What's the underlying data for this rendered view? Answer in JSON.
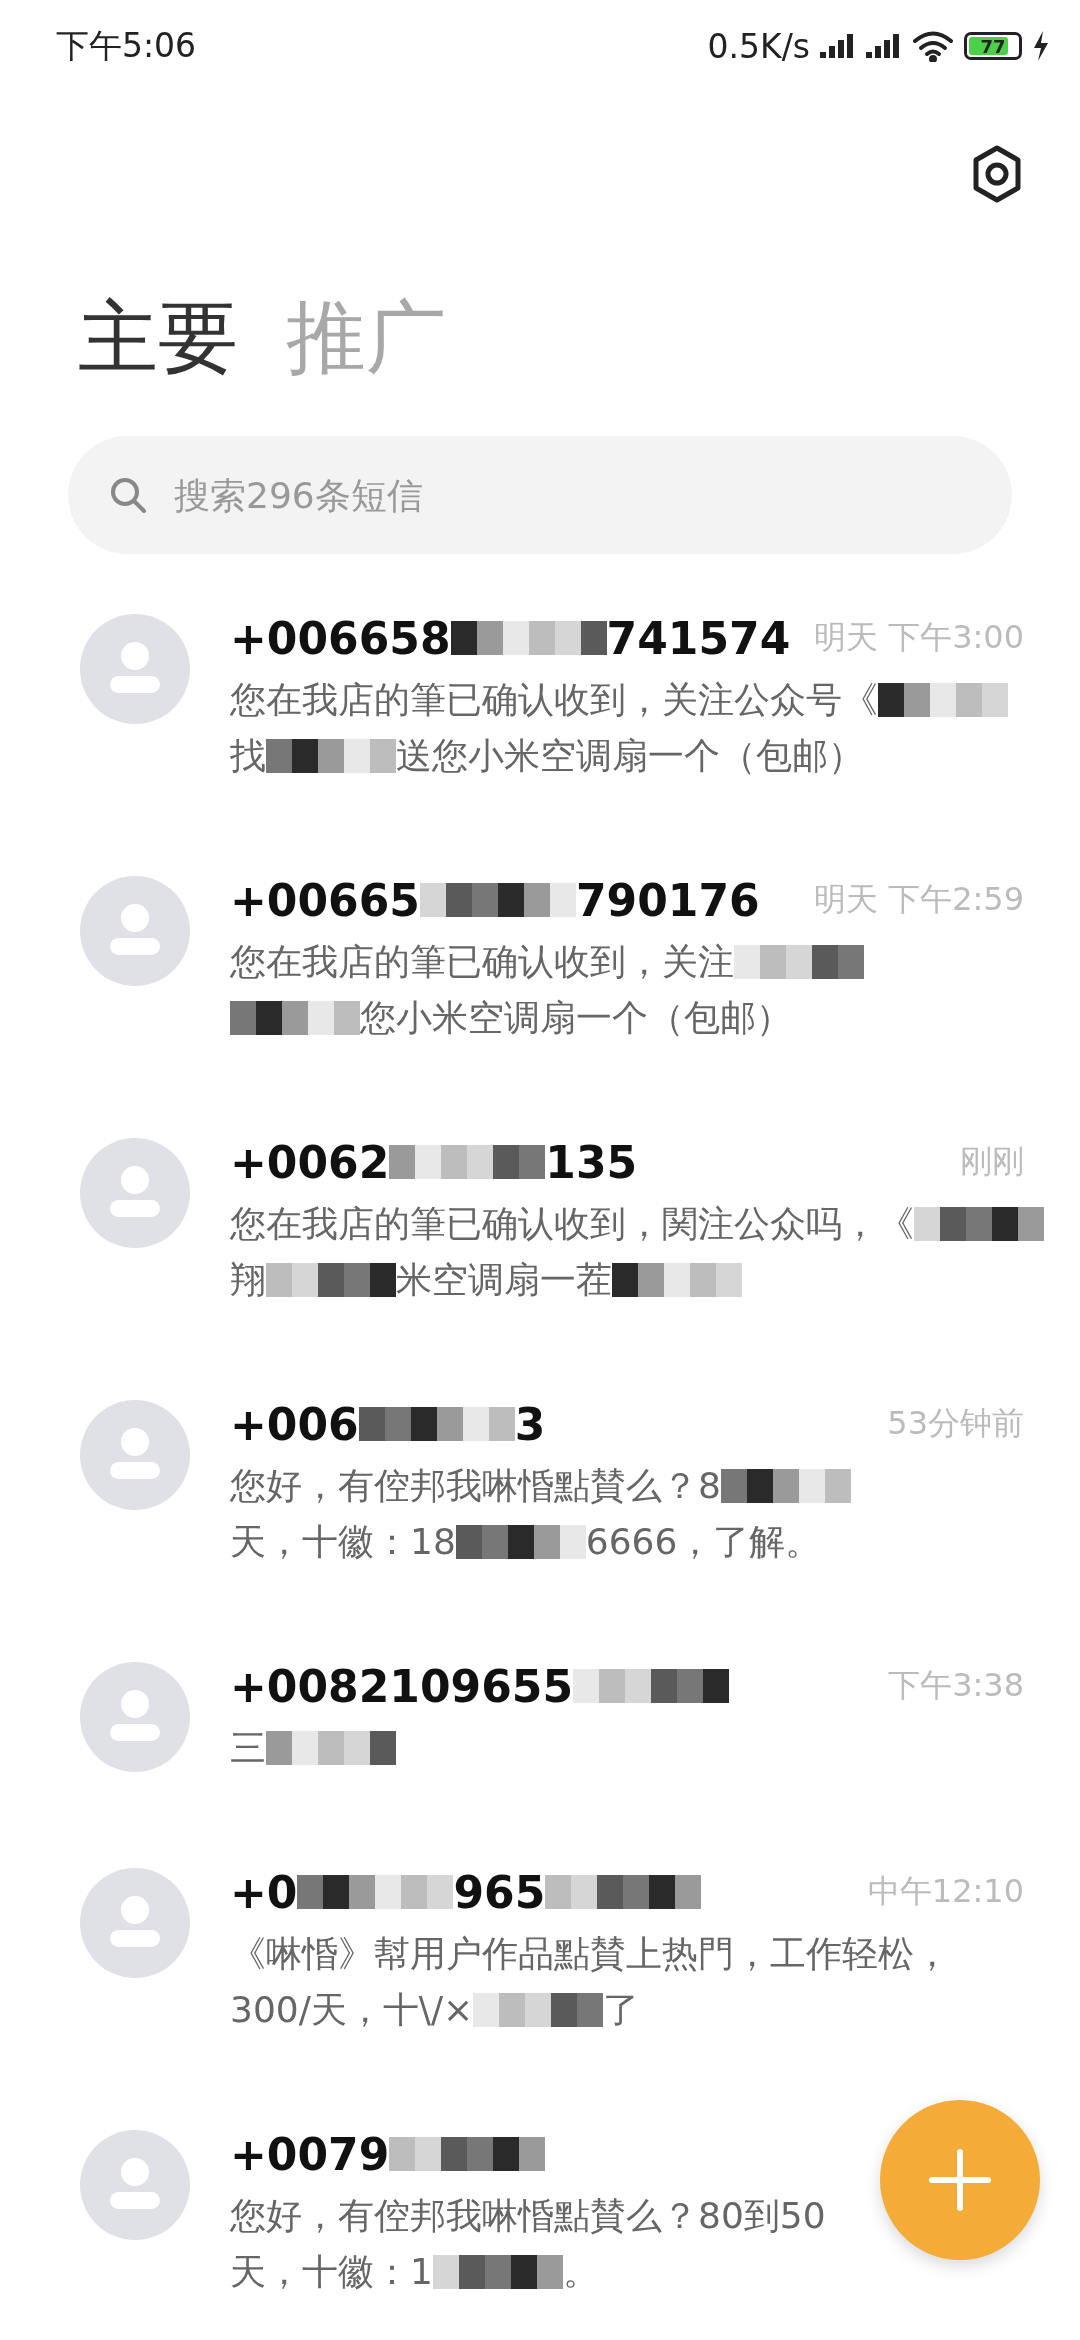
{
  "status_bar": {
    "time": "下午5:06",
    "speed": "0.5K/s",
    "battery": "77",
    "charging": true
  },
  "tabs": [
    {
      "label": "主要",
      "selected": true
    },
    {
      "label": "推广",
      "selected": false
    }
  ],
  "search": {
    "placeholder": "搜索296条短信"
  },
  "conversations": [
    {
      "name": [
        {
          "kind": "text",
          "text": "+006658"
        },
        {
          "kind": "mosaic"
        },
        {
          "kind": "text",
          "text": "741574"
        }
      ],
      "time": "明天 下午3:00",
      "preview": [
        [
          {
            "kind": "text",
            "text": "您在我店的筆已确认收到，关注公众号《"
          },
          {
            "kind": "mosaic"
          }
        ],
        [
          {
            "kind": "text",
            "text": "找"
          },
          {
            "kind": "mosaic"
          },
          {
            "kind": "text",
            "text": "送您小米空调扇一个（包邮）"
          }
        ]
      ]
    },
    {
      "name": [
        {
          "kind": "text",
          "text": "+00665"
        },
        {
          "kind": "mosaic"
        },
        {
          "kind": "text",
          "text": "790176"
        }
      ],
      "time": "明天 下午2:59",
      "preview": [
        [
          {
            "kind": "text",
            "text": "您在我店的筆已确认收到，关注"
          },
          {
            "kind": "mosaic"
          }
        ],
        [
          {
            "kind": "mosaic"
          },
          {
            "kind": "text",
            "text": "您小米空调扇一个（包邮）"
          }
        ]
      ]
    },
    {
      "name": [
        {
          "kind": "text",
          "text": "+0062"
        },
        {
          "kind": "mosaic"
        },
        {
          "kind": "text",
          "text": "135"
        }
      ],
      "time": "刚刚",
      "preview": [
        [
          {
            "kind": "text",
            "text": "您在我店的筆已确认收到，関注公众吗，《"
          },
          {
            "kind": "mosaic"
          }
        ],
        [
          {
            "kind": "text",
            "text": "翔"
          },
          {
            "kind": "mosaic"
          },
          {
            "kind": "text",
            "text": "米空调扇一茬"
          },
          {
            "kind": "mosaic"
          }
        ]
      ]
    },
    {
      "name": [
        {
          "kind": "text",
          "text": "+006"
        },
        {
          "kind": "mosaic"
        },
        {
          "kind": "text",
          "text": "3"
        }
      ],
      "time": "53分钟前",
      "preview": [
        [
          {
            "kind": "text",
            "text": "您好，有倥邦我啉惛點賛么？8"
          },
          {
            "kind": "mosaic"
          }
        ],
        [
          {
            "kind": "text",
            "text": "天，十徽：18"
          },
          {
            "kind": "mosaic"
          },
          {
            "kind": "text",
            "text": "6666，了解。"
          }
        ]
      ]
    },
    {
      "name": [
        {
          "kind": "text",
          "text": "+0082109655"
        },
        {
          "kind": "mosaic"
        }
      ],
      "time": "下午3:38",
      "preview": [
        [
          {
            "kind": "text",
            "text": "三"
          },
          {
            "kind": "mosaic"
          }
        ]
      ]
    },
    {
      "name": [
        {
          "kind": "text",
          "text": "+0"
        },
        {
          "kind": "mosaic"
        },
        {
          "kind": "text",
          "text": "965"
        },
        {
          "kind": "mosaic"
        }
      ],
      "time": "中午12:10",
      "preview": [
        [
          {
            "kind": "text",
            "text": "《啉惛》幇用户作品點賛上热門，工作轻松，"
          }
        ],
        [
          {
            "kind": "text",
            "text": "300/天，十\\/×"
          },
          {
            "kind": "mosaic"
          },
          {
            "kind": "text",
            "text": "了"
          }
        ]
      ]
    },
    {
      "name": [
        {
          "kind": "text",
          "text": "+0079"
        },
        {
          "kind": "mosaic"
        }
      ],
      "preview": [
        [
          {
            "kind": "text",
            "text": "您好，有倥邦我啉惛點賛么？80到50"
          }
        ],
        [
          {
            "kind": "text",
            "text": "天，十徽：1"
          },
          {
            "kind": "mosaic"
          },
          {
            "kind": "text",
            "text": "。"
          }
        ]
      ]
    }
  ]
}
